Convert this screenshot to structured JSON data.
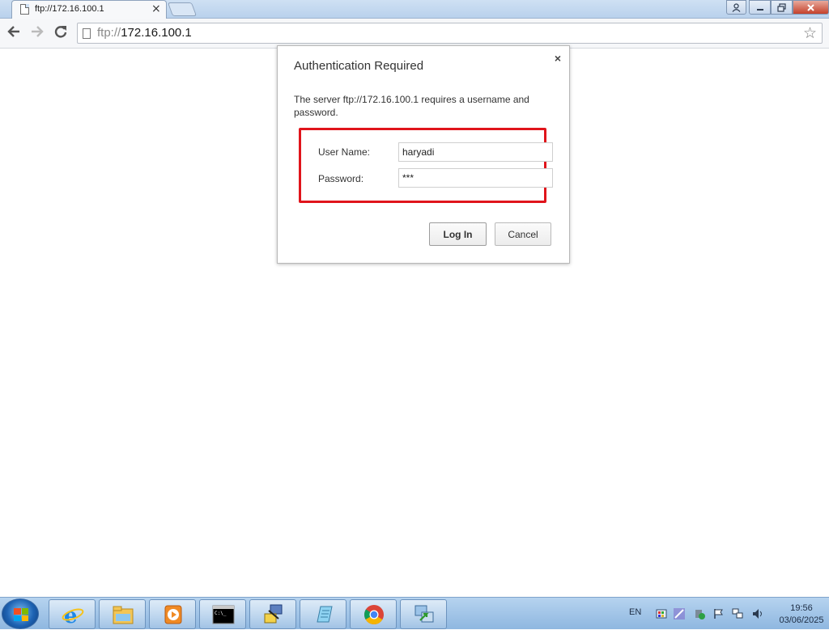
{
  "browser": {
    "tab_title": "ftp://172.16.100.1",
    "tab_close": "×",
    "url_scheme": "ftp://",
    "url_host": "172.16.100.1",
    "back_icon": "arrow-left-icon",
    "forward_icon": "arrow-right-icon",
    "reload_icon": "reload-icon",
    "bookmark_icon": "star-icon"
  },
  "window_controls": {
    "user": "user-icon",
    "minimize": "minimize-icon",
    "restore": "restore-icon",
    "close": "close-icon"
  },
  "dialog": {
    "title": "Authentication Required",
    "close": "×",
    "message": "The server ftp://172.16.100.1 requires a username and password.",
    "username_label": "User Name:",
    "username_value": "haryadi",
    "password_label": "Password:",
    "password_value": "***",
    "login_button": "Log In",
    "cancel_button": "Cancel",
    "highlight_color": "#e0141b"
  },
  "taskbar": {
    "start_icon": "windows-start-icon",
    "apps": [
      {
        "name": "internet-explorer-icon"
      },
      {
        "name": "file-explorer-icon"
      },
      {
        "name": "media-player-icon"
      },
      {
        "name": "command-prompt-icon"
      },
      {
        "name": "network-tool-icon"
      },
      {
        "name": "notepad-icon"
      },
      {
        "name": "chrome-icon"
      },
      {
        "name": "network-share-icon"
      }
    ],
    "language": "EN",
    "time": "19:56",
    "date": "03/06/2025"
  }
}
